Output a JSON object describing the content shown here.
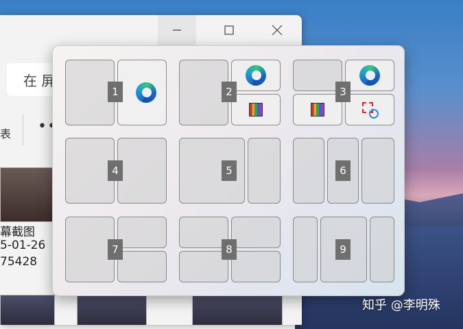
{
  "window": {
    "search_text": "在 屏",
    "toolbar_fragment": "表",
    "more_label": "•••",
    "file": {
      "line1": "幕截图",
      "line2": "5-01-26",
      "line3": "75428"
    }
  },
  "snap_layouts": {
    "numbers": [
      "1",
      "2",
      "3",
      "4",
      "5",
      "6",
      "7",
      "8",
      "9"
    ],
    "icons": [
      "edge-icon",
      "paint-icon",
      "snipping-tool-icon"
    ]
  },
  "watermark": "知乎 @李明殊",
  "colors": {
    "number_badge": "#6f6f6f",
    "cell_border": "#8a8a8a"
  }
}
